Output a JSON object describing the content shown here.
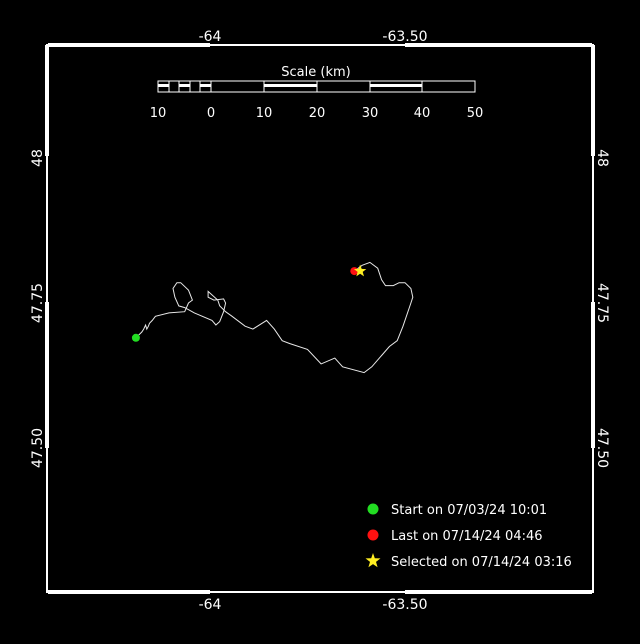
{
  "map": {
    "x_ticks": [
      {
        "label": "-64",
        "value": -64.0
      },
      {
        "label": "-63.50",
        "value": -63.5
      }
    ],
    "y_ticks": [
      {
        "label": "48",
        "value": 48.0
      },
      {
        "label": "47.75",
        "value": 47.75
      },
      {
        "label": "47.50",
        "value": 47.5
      }
    ],
    "scale_bar": {
      "title": "Scale (km)",
      "labels": [
        "10",
        "0",
        "10",
        "20",
        "30",
        "40",
        "50"
      ]
    },
    "legend": [
      {
        "label": "Start on 07/03/24 10:01",
        "color": "#22dd22",
        "marker": "circle"
      },
      {
        "label": "Last on 07/14/24 04:46",
        "color": "#ff1111",
        "marker": "circle"
      },
      {
        "label": "Selected on 07/14/24 03:16",
        "color": "#ffee22",
        "marker": "star"
      }
    ],
    "start": {
      "lon": -64.19,
      "lat": 47.69
    },
    "last": {
      "lon": -63.63,
      "lat": 47.805
    },
    "selected": {
      "lon": -63.615,
      "lat": 47.805
    },
    "track": [
      [
        -64.19,
        47.69
      ],
      [
        -64.175,
        47.7
      ],
      [
        -64.17,
        47.705
      ],
      [
        -64.165,
        47.712
      ],
      [
        -64.162,
        47.705
      ],
      [
        -64.158,
        47.71
      ],
      [
        -64.155,
        47.715
      ],
      [
        -64.148,
        47.72
      ],
      [
        -64.14,
        47.727
      ],
      [
        -64.105,
        47.733
      ],
      [
        -64.065,
        47.735
      ],
      [
        -64.055,
        47.75
      ],
      [
        -64.045,
        47.755
      ],
      [
        -64.055,
        47.772
      ],
      [
        -64.075,
        47.785
      ],
      [
        -64.085,
        47.785
      ],
      [
        -64.095,
        47.775
      ],
      [
        -64.09,
        47.76
      ],
      [
        -64.08,
        47.745
      ],
      [
        -64.065,
        47.742
      ],
      [
        -64.04,
        47.733
      ],
      [
        -63.995,
        47.72
      ],
      [
        -63.985,
        47.712
      ],
      [
        -63.975,
        47.718
      ],
      [
        -63.965,
        47.735
      ],
      [
        -63.96,
        47.75
      ],
      [
        -63.965,
        47.757
      ],
      [
        -63.99,
        47.755
      ],
      [
        -64.005,
        47.76
      ],
      [
        -64.005,
        47.77
      ],
      [
        -63.98,
        47.755
      ],
      [
        -63.975,
        47.745
      ],
      [
        -63.96,
        47.735
      ],
      [
        -63.945,
        47.728
      ],
      [
        -63.91,
        47.71
      ],
      [
        -63.89,
        47.705
      ],
      [
        -63.855,
        47.72
      ],
      [
        -63.835,
        47.705
      ],
      [
        -63.815,
        47.685
      ],
      [
        -63.795,
        47.68
      ],
      [
        -63.75,
        47.67
      ],
      [
        -63.715,
        47.645
      ],
      [
        -63.68,
        47.655
      ],
      [
        -63.66,
        47.64
      ],
      [
        -63.605,
        47.63
      ],
      [
        -63.585,
        47.64
      ],
      [
        -63.54,
        47.675
      ],
      [
        -63.52,
        47.685
      ],
      [
        -63.505,
        47.71
      ],
      [
        -63.485,
        47.75
      ],
      [
        -63.48,
        47.76
      ],
      [
        -63.485,
        47.775
      ],
      [
        -63.5,
        47.785
      ],
      [
        -63.515,
        47.785
      ],
      [
        -63.53,
        47.78
      ],
      [
        -63.55,
        47.78
      ],
      [
        -63.56,
        47.79
      ],
      [
        -63.57,
        47.81
      ],
      [
        -63.59,
        47.82
      ],
      [
        -63.61,
        47.815
      ],
      [
        -63.63,
        47.805
      ]
    ]
  }
}
